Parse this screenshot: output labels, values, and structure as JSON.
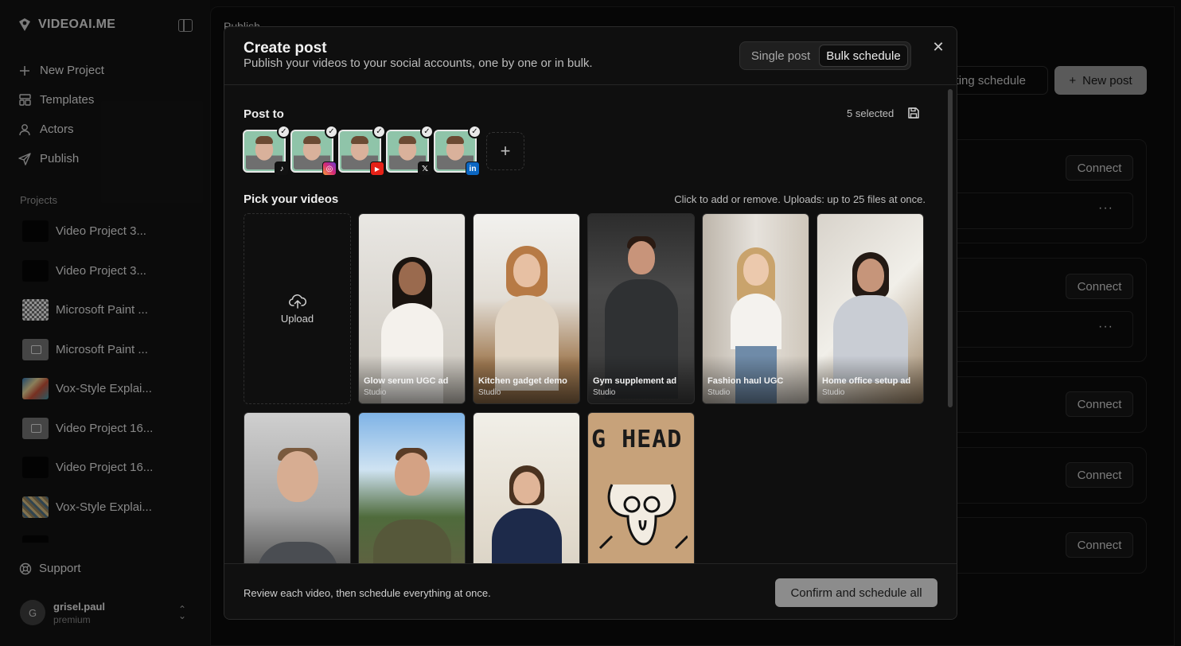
{
  "sidebar": {
    "brand": "VIDEOAI.ME",
    "nav": [
      {
        "label": "New Project",
        "icon": "plus-icon"
      },
      {
        "label": "Templates",
        "icon": "templates-icon"
      },
      {
        "label": "Actors",
        "icon": "actors-icon"
      },
      {
        "label": "Publish",
        "icon": "send-icon"
      }
    ],
    "projects_label": "Projects",
    "projects": [
      {
        "name": "Video Project 3...",
        "thumb": "dark"
      },
      {
        "name": "Video Project 3...",
        "thumb": "dark"
      },
      {
        "name": "Microsoft Paint ...",
        "thumb": "pixel"
      },
      {
        "name": "Microsoft Paint ...",
        "thumb": "image"
      },
      {
        "name": "Vox-Style Explai...",
        "thumb": "vox"
      },
      {
        "name": "Video Project 16...",
        "thumb": "image"
      },
      {
        "name": "Video Project 16...",
        "thumb": "dark"
      },
      {
        "name": "Vox-Style Explai...",
        "thumb": "vox2"
      }
    ],
    "support": "Support",
    "user": {
      "initial": "G",
      "name": "grisel.paul",
      "plan": "premium"
    }
  },
  "background": {
    "title": "Publish",
    "posting_schedule": "sting schedule",
    "new_post": "New post",
    "connect": "Connect",
    "card_fragment": ")",
    "dots": "···"
  },
  "modal": {
    "title": "Create post",
    "subtitle": "Publish your videos to your social accounts, one by one or in bulk.",
    "tabs": {
      "single": "Single post",
      "bulk": "Bulk schedule"
    },
    "post_to": "Post to",
    "selected_count": "5 selected",
    "accounts": [
      {
        "platform": "tiktok",
        "badge_color": "#111111",
        "badge_text": "♪"
      },
      {
        "platform": "instagram",
        "badge_color": "#d62976",
        "badge_text": "◎"
      },
      {
        "platform": "youtube",
        "badge_color": "#e62117",
        "badge_text": "▶"
      },
      {
        "platform": "x",
        "badge_color": "#111111",
        "badge_text": "𝕏"
      },
      {
        "platform": "linkedin",
        "badge_color": "#0a66c2",
        "badge_text": "in"
      }
    ],
    "pick_label": "Pick your videos",
    "pick_hint": "Click to add or remove. Uploads: up to 25 files at once.",
    "upload": "Upload",
    "videos": [
      {
        "title": "Glow serum UGC ad",
        "source": "Studio"
      },
      {
        "title": "Kitchen gadget demo",
        "source": "Studio"
      },
      {
        "title": "Gym supplement ad",
        "source": "Studio"
      },
      {
        "title": "Fashion haul UGC",
        "source": "Studio"
      },
      {
        "title": "Home office setup ad",
        "source": "Studio"
      }
    ],
    "art_text": "G HEAD",
    "footer_text": "Review each video, then schedule everything at once.",
    "confirm": "Confirm and schedule all"
  }
}
